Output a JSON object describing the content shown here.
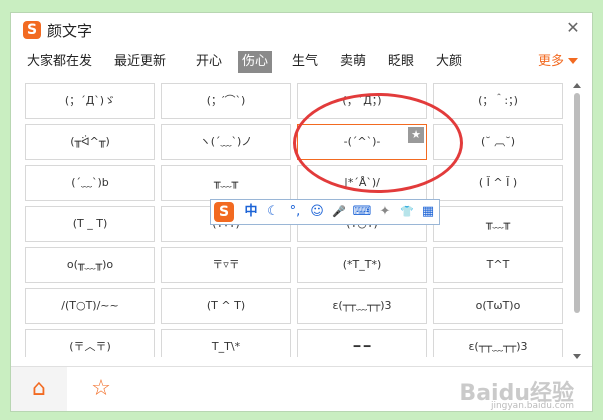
{
  "window": {
    "title": "颜文字",
    "logo_glyph": "S",
    "close_label": "✕"
  },
  "tabs": [
    "大家都在发",
    "最近更新",
    "开心",
    "伤心",
    "生气",
    "卖萌",
    "眨眼",
    "大颜"
  ],
  "active_tab": "伤心",
  "more_label": "更多",
  "cells": [
    [
      "(；´Д`)ゞ",
      "(；′⌒`)",
      "(；´Д；)",
      "(；＾:；)"
    ],
    [
      "(╥ᐛ^╥)",
      "ヽ(´﹏`)ノ",
      "-(ˊ^ˋ)-",
      "(˘ ︹˘)"
    ],
    [
      "(´﹏`)b",
      "╥﹏╥",
      "|*´Å`)/",
      "( Ĭ ^ Ĭ )"
    ],
    [
      "(T _ T)",
      "(T▿T)",
      "(T○T)",
      "╥﹏╥"
    ],
    [
      "o(╥﹏╥)o",
      "〒▿〒",
      "(*T_T*)",
      "T^T"
    ],
    [
      "/(T○T)/~~",
      "(T ^ T)",
      "ε(┬┬﹏┬┬)3",
      "o(TωT)o"
    ],
    [
      "(〒︿〒)",
      "T_T\\*",
      "━ ━",
      "ε(┬┬﹏┬┬)3"
    ]
  ],
  "selected_cell": "-(ˊ^ˋ)-",
  "star_glyph": "★",
  "floating_toolbar": {
    "logo": "S",
    "items": [
      {
        "name": "chinese-mode",
        "glyph": "中"
      },
      {
        "name": "moon-icon",
        "glyph": "☾"
      },
      {
        "name": "punctuation-icon",
        "glyph": "°,"
      },
      {
        "name": "smiley-icon",
        "glyph": "☺"
      },
      {
        "name": "mic-icon",
        "glyph": "🎤"
      },
      {
        "name": "keyboard-icon",
        "glyph": "⌨"
      },
      {
        "name": "tools-icon",
        "glyph": "✦"
      },
      {
        "name": "skin-icon",
        "glyph": "👕"
      },
      {
        "name": "grid-menu-icon",
        "glyph": "▦"
      }
    ]
  },
  "bottom": {
    "home_glyph": "⌂",
    "fav_glyph": "☆"
  },
  "watermark": {
    "text": "Baidu经验",
    "sub": "jingyan.baidu.com"
  },
  "colors": {
    "accent": "#f26a21",
    "annotation": "#e23b3b",
    "background": "#c9eec1"
  }
}
